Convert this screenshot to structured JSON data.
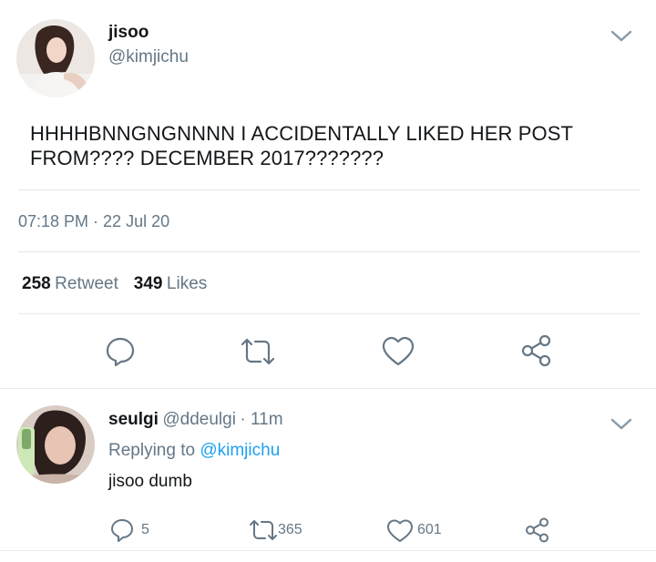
{
  "colors": {
    "accent": "#1da1f2",
    "muted": "#657786",
    "text": "#14171a",
    "divider": "#e1e8ed"
  },
  "tweet": {
    "author_name": "jisoo",
    "author_handle": "@kimjichu",
    "text_line1": "HHHHBNNGNGNNNN I ACCIDENTALLY LIKED HER POST",
    "text_line2": "FROM???? DECEMBER 2017???????",
    "timestamp": "07:18 PM · 22 Jul 20",
    "retweet_count": "258",
    "retweet_label": "Retweet",
    "like_count": "349",
    "like_label": "Likes",
    "icons": [
      "reply-icon",
      "retweet-icon",
      "heart-icon",
      "share-icon",
      "chevron-down-icon"
    ]
  },
  "reply": {
    "author_name": "seulgi",
    "author_handle": "@ddeulgi",
    "time": "· 11m",
    "replying_prefix": "Replying to",
    "replying_to": "@kimjichu",
    "text": "jisoo dumb",
    "reply_count": "5",
    "retweet_count": "365",
    "like_count": "601",
    "icons": [
      "reply-icon",
      "retweet-icon",
      "heart-icon",
      "share-icon",
      "chevron-down-icon"
    ]
  }
}
